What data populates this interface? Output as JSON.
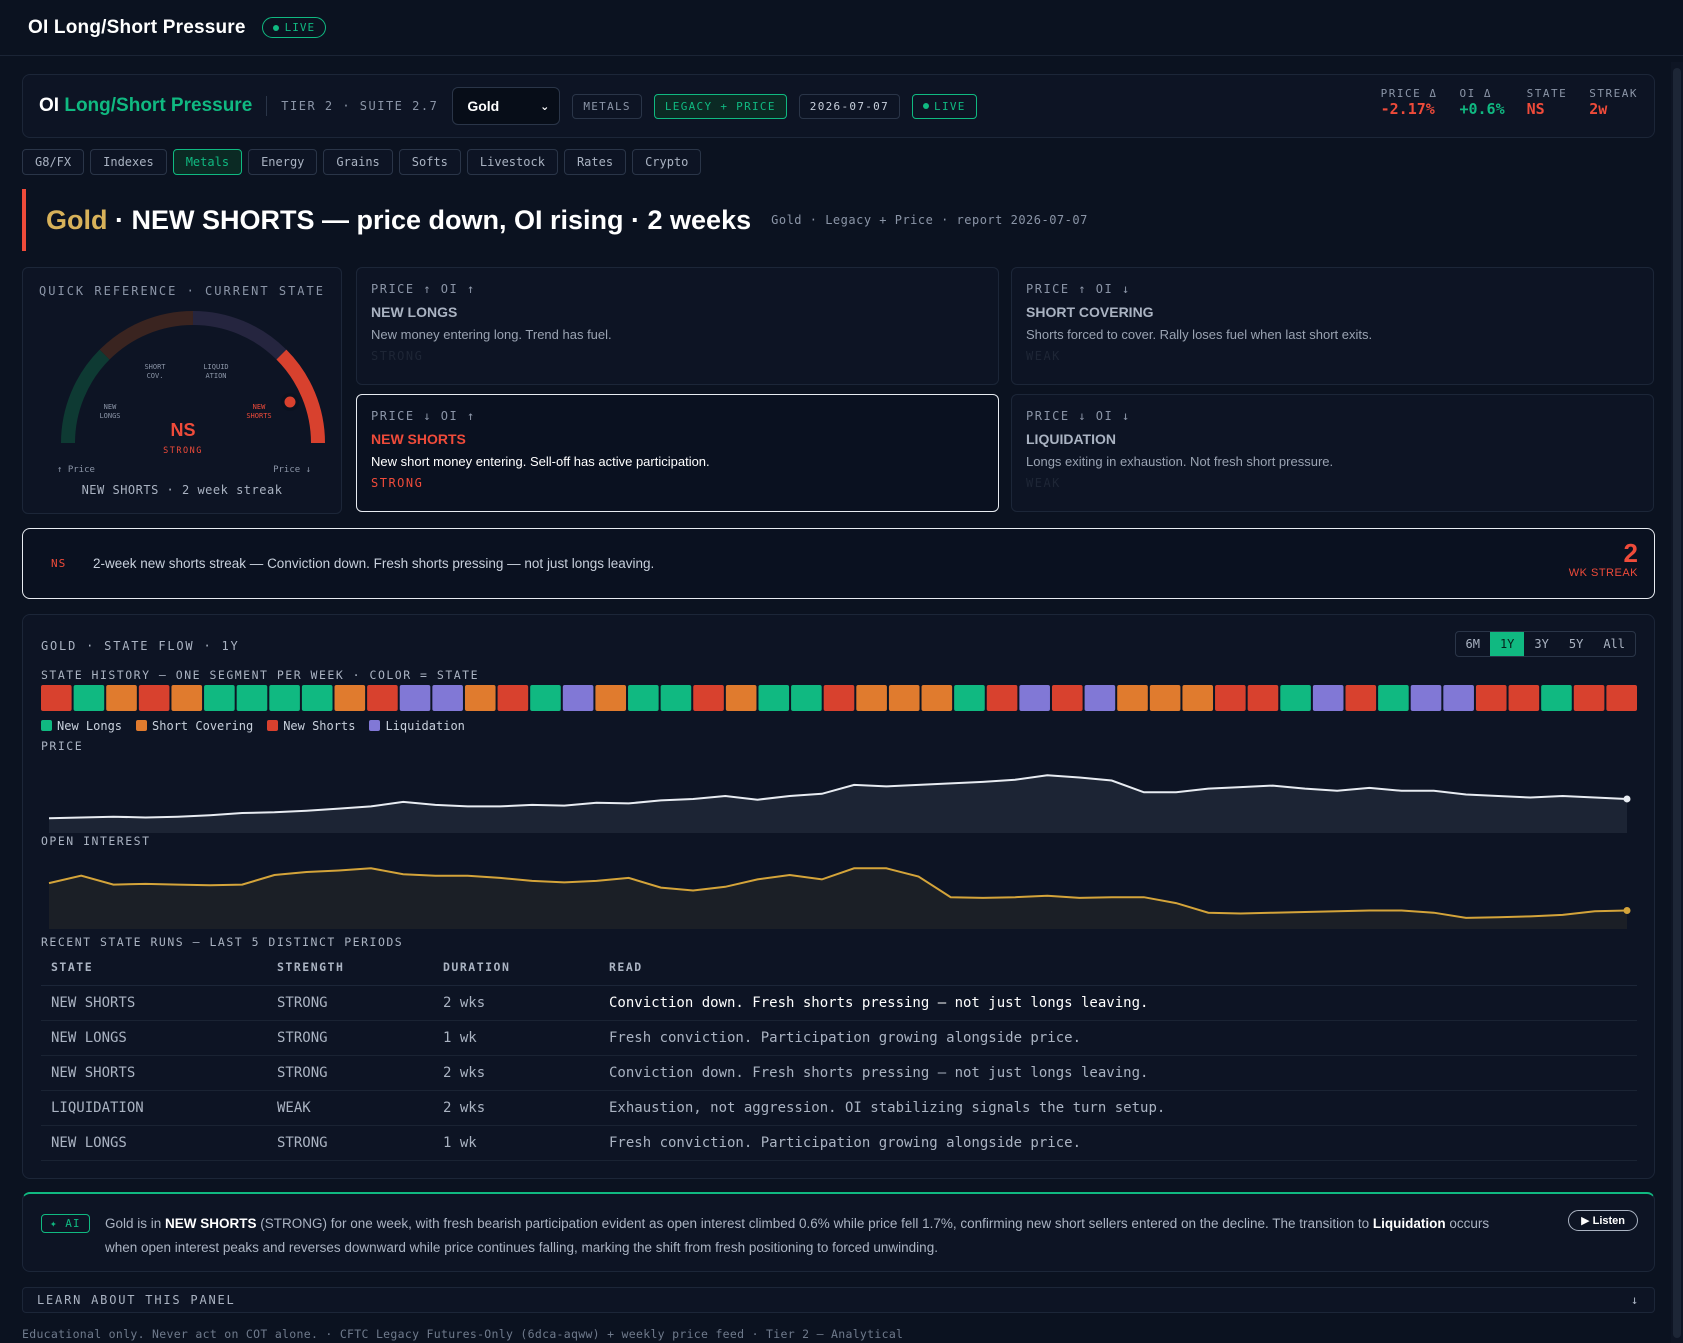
{
  "app": {
    "title": "OI Long/Short Pressure",
    "live": "LIVE"
  },
  "header": {
    "title_prefix": "OI",
    "title_accent": "Long/Short Pressure",
    "tier": "TIER 2 · SUITE 2.7",
    "selected_market": "Gold",
    "sector_chip": "METALS",
    "report_chip": "LEGACY + PRICE",
    "date_chip": "2026-07-07",
    "live": "LIVE",
    "stats": [
      {
        "label": "PRICE Δ",
        "value": "-2.17%"
      },
      {
        "label": "OI Δ",
        "value": "+0.6%"
      },
      {
        "label": "STATE",
        "value": "NS"
      },
      {
        "label": "STREAK",
        "value": "2w"
      }
    ]
  },
  "tabs": [
    "G8/FX",
    "Indexes",
    "Metals",
    "Energy",
    "Grains",
    "Softs",
    "Livestock",
    "Rates",
    "Crypto"
  ],
  "active_tab": "Metals",
  "headline": {
    "market": "Gold",
    "text": " · NEW SHORTS — price down, OI rising · 2 weeks",
    "sub": "Gold · Legacy + Price · report 2026-07-07"
  },
  "quick_ref": {
    "title": "QUICK REFERENCE · CURRENT STATE",
    "gauge_labels": {
      "short_cov_1": "SHORT",
      "short_cov_2": "COV.",
      "liq_1": "LIQUID",
      "liq_2": "ATION",
      "new_longs_1": "NEW",
      "new_longs_2": "LONGS",
      "new_shorts_1": "NEW",
      "new_shorts_2": "SHORTS"
    },
    "current_code": "NS",
    "current_strength": "STRONG",
    "left_axis": "↑ Price",
    "right_axis": "Price ↓",
    "summary": "NEW SHORTS · 2 week streak"
  },
  "states": [
    {
      "key": "PRICE ↑ OI ↑",
      "name": "NEW LONGS",
      "desc": "New money entering long. Trend has fuel.",
      "strength": "STRONG"
    },
    {
      "key": "PRICE ↑ OI ↓",
      "name": "SHORT COVERING",
      "desc": "Shorts forced to cover. Rally loses fuel when last short exits.",
      "strength": "WEAK"
    },
    {
      "key": "PRICE ↓ OI ↑",
      "name": "NEW SHORTS",
      "desc": "New short money entering. Sell-off has active participation.",
      "strength": "STRONG"
    },
    {
      "key": "PRICE ↓ OI ↓",
      "name": "LIQUIDATION",
      "desc": "Longs exiting in exhaustion. Not fresh short pressure.",
      "strength": "WEAK"
    }
  ],
  "streak": {
    "code": "NS",
    "text": "2-week new shorts streak — Conviction down. Fresh shorts pressing — not just longs leaving.",
    "count": "2",
    "count_label": "WK STREAK"
  },
  "flow": {
    "title": "GOLD · STATE FLOW · 1Y",
    "ranges": [
      "6M",
      "1Y",
      "3Y",
      "5Y",
      "All"
    ],
    "active_range": "1Y",
    "history_label": "STATE HISTORY — ONE SEGMENT PER WEEK · COLOR = STATE",
    "legend": [
      {
        "name": "New Longs",
        "color": "#10b981"
      },
      {
        "name": "Short Covering",
        "color": "#e07b2e"
      },
      {
        "name": "New Shorts",
        "color": "#d8412e"
      },
      {
        "name": "Liquidation",
        "color": "#8178d6"
      }
    ],
    "history": [
      "NS",
      "NL",
      "SC",
      "NS",
      "SC",
      "NL",
      "NL",
      "NL",
      "NL",
      "SC",
      "NS",
      "LQ",
      "LQ",
      "SC",
      "NS",
      "NL",
      "LQ",
      "SC",
      "NL",
      "NL",
      "NS",
      "SC",
      "NL",
      "NL",
      "NS",
      "SC",
      "SC",
      "SC",
      "NL",
      "NS",
      "LQ",
      "NS",
      "LQ",
      "SC",
      "SC",
      "SC",
      "NS",
      "NS",
      "NL",
      "LQ",
      "NS",
      "NL",
      "LQ",
      "LQ",
      "NS",
      "NS",
      "NL",
      "NS",
      "NS"
    ],
    "price_label": "PRICE",
    "oi_label": "OPEN INTEREST",
    "runs_label": "RECENT STATE RUNS — LAST 5 DISTINCT PERIODS",
    "runs_headers": [
      "STATE",
      "STRENGTH",
      "DURATION",
      "READ"
    ],
    "runs": [
      {
        "state": "NEW SHORTS",
        "strength": "STRONG",
        "duration": "2 wks",
        "read": "Conviction down. Fresh shorts pressing — not just longs leaving.",
        "color": "#ef4b3a"
      },
      {
        "state": "NEW LONGS",
        "strength": "STRONG",
        "duration": "1 wk",
        "read": "Fresh conviction. Participation growing alongside price.",
        "color": "#10b981"
      },
      {
        "state": "NEW SHORTS",
        "strength": "STRONG",
        "duration": "2 wks",
        "read": "Conviction down. Fresh shorts pressing — not just longs leaving.",
        "color": "#ef4b3a"
      },
      {
        "state": "LIQUIDATION",
        "strength": "WEAK",
        "duration": "2 wks",
        "read": "Exhaustion, not aggression. OI stabilizing signals the turn setup.",
        "color": "#8b84e0"
      },
      {
        "state": "NEW LONGS",
        "strength": "STRONG",
        "duration": "1 wk",
        "read": "Fresh conviction. Participation growing alongside price.",
        "color": "#10b981"
      }
    ]
  },
  "chart_data": [
    {
      "type": "area",
      "title": "PRICE",
      "series": [
        {
          "values": [
            20,
            21,
            22,
            21,
            22,
            24,
            27,
            28,
            30,
            33,
            36,
            42,
            38,
            36,
            36,
            38,
            37,
            41,
            40,
            44,
            46,
            50,
            45,
            50,
            53,
            65,
            63,
            65,
            67,
            69,
            72,
            78,
            75,
            71,
            55,
            55,
            60,
            62,
            64,
            60,
            57,
            61,
            57,
            57,
            52,
            50,
            48,
            50,
            48,
            46
          ]
        }
      ]
    },
    {
      "type": "area",
      "title": "OPEN INTEREST",
      "series": [
        {
          "values": [
            62,
            72,
            60,
            61,
            60,
            59,
            60,
            73,
            77,
            79,
            82,
            74,
            72,
            72,
            69,
            65,
            63,
            65,
            69,
            56,
            52,
            57,
            67,
            73,
            67,
            82,
            82,
            71,
            43,
            42,
            43,
            45,
            42,
            43,
            43,
            35,
            22,
            21,
            22,
            23,
            24,
            25,
            25,
            22,
            15,
            16,
            17,
            19,
            24,
            25
          ]
        }
      ]
    }
  ],
  "ai": {
    "tag": "✦ AI",
    "p1": "Gold is in ",
    "b1": "NEW SHORTS",
    "p2": " (STRONG) for one week, with fresh bearish participation evident as open interest climbed 0.6% while price fell 1.7%, confirming new short sellers entered on the decline. The transition to ",
    "b2": "Liquidation",
    "p3": " occurs when open interest peaks and reverses downward while price continues falling, marking the shift from fresh positioning to forced unwinding.",
    "listen": "▶ Listen"
  },
  "learn": {
    "label": "LEARN ABOUT THIS PANEL",
    "arrow": "↓"
  },
  "footer": "Educational only. Never act on COT alone. · CFTC Legacy Futures-Only (6dca-aqww) + weekly price feed · Tier 2 — Analytical"
}
